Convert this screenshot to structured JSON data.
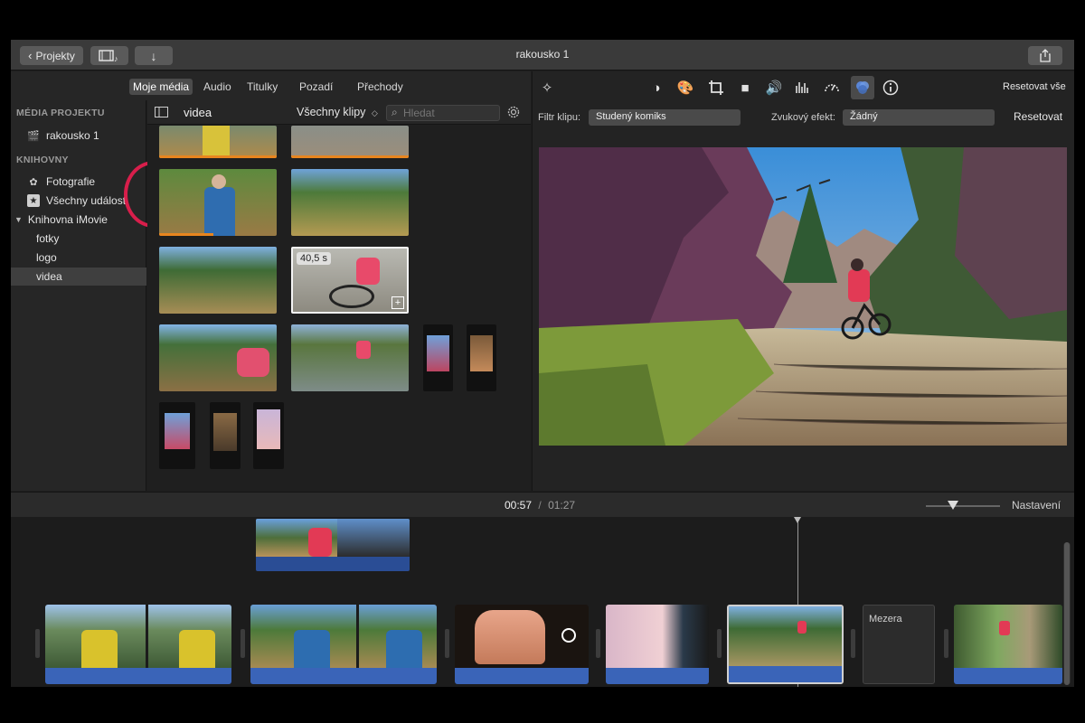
{
  "window": {
    "title": "rakousko 1",
    "back_label": "Projekty"
  },
  "tabs": [
    "Moje média",
    "Audio",
    "Titulky",
    "Pozadí",
    "Přechody"
  ],
  "sidebar": {
    "section_project": "MÉDIA PROJEKTU",
    "project_item": "rakousko 1",
    "section_libraries": "KNIHOVNY",
    "items": [
      "Fotografie",
      "Všechny události",
      "Knihovna iMovie",
      "fotky",
      "logo",
      "videa"
    ]
  },
  "browser": {
    "title": "videa",
    "filter_label": "Všechny klipy",
    "search_placeholder": "Hledat",
    "selected_duration": "40,5 s"
  },
  "viewer": {
    "reset_all": "Resetovat vše",
    "clip_filter_label": "Filtr klipu:",
    "clip_filter_value": "Studený komiks",
    "audio_effect_label": "Zvukový efekt:",
    "audio_effect_value": "Žádný",
    "reset": "Resetovat"
  },
  "timeline": {
    "current_time": "00:57",
    "separator": "/",
    "total_time": "01:27",
    "settings": "Nastavení",
    "gap_label": "Mezera"
  },
  "colors": {
    "accent_blue": "#3a64b8",
    "highlight": "#d81e4b",
    "orange_bar": "#e8851f"
  }
}
